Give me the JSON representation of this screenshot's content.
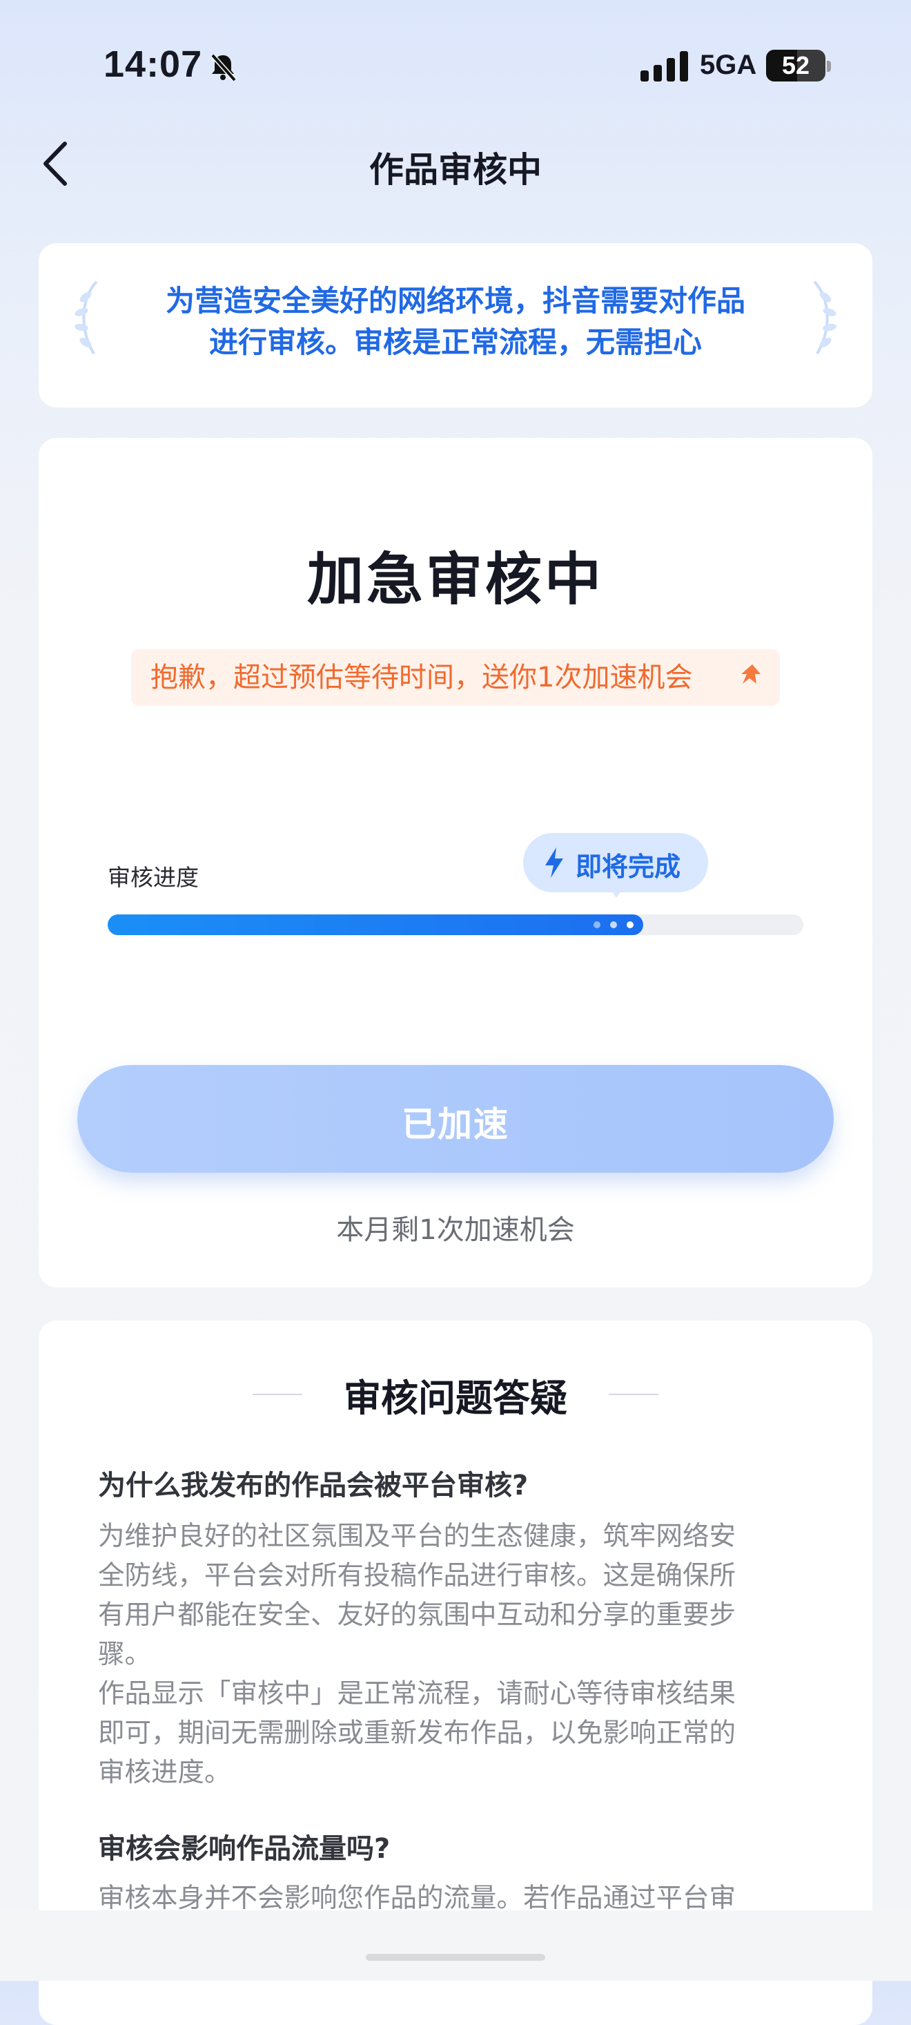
{
  "status_bar": {
    "time": "14:07",
    "network": "5GA",
    "battery": "52",
    "bell_icon": "bell-slash-icon",
    "signal_icon": "cellular-signal-icon"
  },
  "nav": {
    "back_icon": "chevron-left-icon",
    "title": "作品审核中"
  },
  "notice": {
    "line1": "为营造安全美好的网络环境，抖音需要对作品",
    "line2": "进行审核。审核是正常流程，无需担心",
    "decoration_icon": "laurel-icon"
  },
  "status_card": {
    "title": "加急审核中",
    "apology": "抱歉，超过预估等待时间，送你1次加速机会",
    "apology_icon": "rocket-icon",
    "progress_label": "审核进度",
    "progress_value": 0.77,
    "progress_badge": "即将完成",
    "badge_icon": "lightning-icon",
    "button_label": "已加速",
    "remaining_text": "本月剩1次加速机会"
  },
  "faq": {
    "title": "审核问题答疑",
    "items": [
      {
        "question": "为什么我发布的作品会被平台审核?",
        "answer_lines": [
          "为维护良好的社区氛围及平台的生态健康，筑牢网络安",
          "全防线，平台会对所有投稿作品进行审核。这是确保所",
          "有用户都能在安全、友好的氛围中互动和分享的重要步",
          "骤。",
          "作品显示「审核中」是正常流程，请耐心等待审核结果",
          "即可，期间无需删除或重新发布作品，以免影响正常的",
          "审核进度。"
        ]
      },
      {
        "question": "审核会影响作品流量吗?",
        "answer_lines": [
          "审核本身并不会影响您作品的流量。若作品通过平台审"
        ]
      }
    ]
  },
  "colors": {
    "accent_blue": "#1f6be6",
    "apology_orange": "#f06a2f",
    "button_disabled": "#a9c6fb"
  }
}
